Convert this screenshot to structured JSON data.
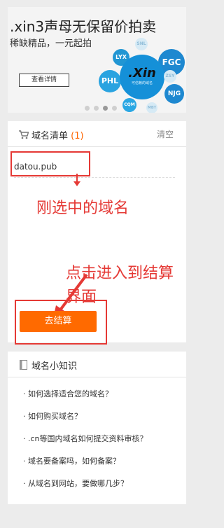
{
  "banner": {
    "title": ".xin3声母无保留价拍卖",
    "subtitle": "稀缺精品，一元起拍",
    "button_label": "查看详情",
    "logo_text": ".Xin",
    "logo_caption": "可信赖的域名",
    "bubbles": [
      "LYX",
      "SNL",
      "FGC",
      "PHL",
      "NJG",
      "CQM",
      "ZSY",
      "MBT"
    ],
    "slides_count": 4,
    "active_slide": 3
  },
  "domain_list": {
    "title": "域名清单",
    "count": "(1)",
    "clear_label": "清空",
    "items": [
      "datou.pub"
    ],
    "checkout_label": "去结算"
  },
  "annotations": {
    "selected_label": "刚选中的域名",
    "click_label_line1": "点击进入到结算",
    "click_label_line2": "界面"
  },
  "knowledge": {
    "title": "域名小知识",
    "items": [
      "· 如何选择适合您的域名？",
      "· 如何购买域名？",
      "· .cn等国内域名如何提交资料审核？",
      "· 域名要备案吗，如何备案？",
      "· 从域名到网站，要做哪几步？"
    ]
  },
  "colors": {
    "accent": "#ff6a00",
    "annotation_red": "#e53935",
    "count_orange": "#ff6600"
  }
}
